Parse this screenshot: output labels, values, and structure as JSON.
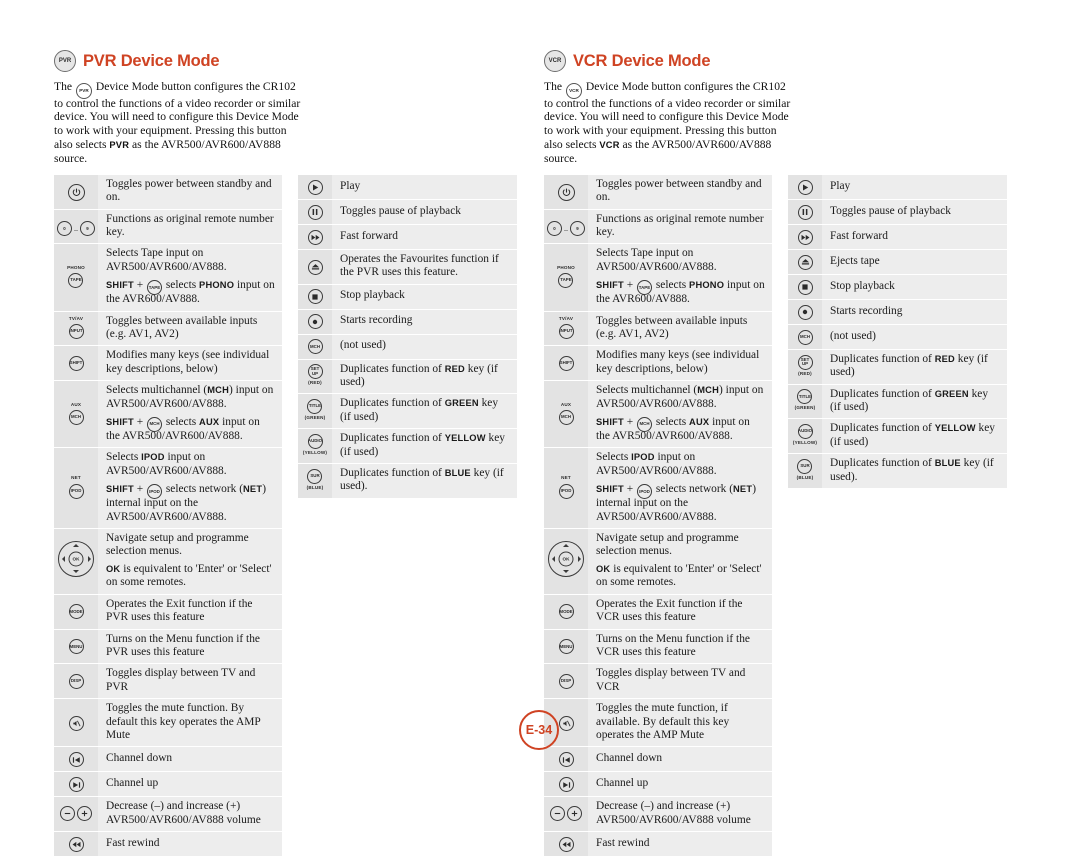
{
  "page": {
    "number_label": "E-34",
    "accent_color": "#cf4323"
  },
  "sections": [
    {
      "id": "pvr",
      "mode_badge": "PVR",
      "title": "PVR Device Mode",
      "intro_pre": "The ",
      "intro_badge": "PVR",
      "intro_mid": " Device Mode button configures the CR102 to control the functions of a video recorder or similar device. You will need to configure this Device Mode to work with your equipment. Pressing this button also selects ",
      "intro_sc": "PVR",
      "intro_post": " as the AVR500/AVR600/AV888 source.",
      "left_rows": [
        {
          "icon": "power-icon",
          "lines": [
            "Toggles power between standby and on."
          ]
        },
        {
          "icon": "number-keys-icon",
          "lines": [
            "Functions as original remote number key."
          ]
        },
        {
          "icon": "phono-tape-icon",
          "lines": [
            "Selects Tape input on AVR500/AVR600/AV888.",
            "SHIFT + TAPE selects PHONO input on the AVR600/AV888."
          ]
        },
        {
          "icon": "tv-av-input-icon",
          "lines": [
            "Toggles between available inputs (e.g. AV1, AV2)"
          ]
        },
        {
          "icon": "shift-icon",
          "lines": [
            "Modifies many keys (see individual key descriptions, below)"
          ]
        },
        {
          "icon": "aux-mch-icon",
          "lines": [
            "Selects multichannel (MCH) input on AVR500/AVR600/AV888.",
            "SHIFT + MCH selects AUX input on the AVR500/AVR600/AV888."
          ]
        },
        {
          "icon": "net-ipod-icon",
          "lines": [
            "Selects IPOD input on AVR500/AVR600/AV888.",
            "SHIFT + IPOD selects network (NET) internal input on the AVR500/AVR600/AV888."
          ]
        },
        {
          "icon": "navigation-dpad-icon",
          "lines": [
            "Navigate setup and programme selection menus.",
            "OK is equivalent to 'Enter' or 'Select' on some remotes."
          ]
        },
        {
          "icon": "mode-exit-icon",
          "lines": [
            "Operates the Exit function if the PVR uses this feature"
          ]
        },
        {
          "icon": "menu-icon",
          "lines": [
            "Turns on the Menu function if the PVR uses this feature"
          ]
        },
        {
          "icon": "display-icon",
          "lines": [
            "Toggles display between TV and PVR"
          ]
        },
        {
          "icon": "mute-icon",
          "lines": [
            "Toggles the mute function. By default this key operates the AMP Mute"
          ]
        },
        {
          "icon": "channel-down-icon",
          "lines": [
            "Channel down"
          ]
        },
        {
          "icon": "channel-up-icon",
          "lines": [
            "Channel up"
          ]
        },
        {
          "icon": "volume-minus-plus-icon",
          "lines": [
            "Decrease (–) and increase (+) AVR500/AVR600/AV888 volume"
          ]
        },
        {
          "icon": "fast-rewind-icon",
          "lines": [
            "Fast rewind"
          ]
        }
      ],
      "right_rows": [
        {
          "icon": "play-icon",
          "lines": [
            "Play"
          ]
        },
        {
          "icon": "pause-icon",
          "lines": [
            "Toggles pause of playback"
          ]
        },
        {
          "icon": "fast-forward-icon",
          "lines": [
            "Fast forward"
          ]
        },
        {
          "icon": "eject-icon",
          "lines": [
            "Operates the Favourites function if the PVR uses this feature."
          ]
        },
        {
          "icon": "stop-icon",
          "lines": [
            "Stop playback"
          ]
        },
        {
          "icon": "record-icon",
          "lines": [
            "Starts recording"
          ]
        },
        {
          "icon": "mch-icon",
          "lines": [
            "(not used)"
          ]
        },
        {
          "icon": "setup-red-icon",
          "lines": [
            "Duplicates function of RED key (if used)"
          ]
        },
        {
          "icon": "title-green-icon",
          "lines": [
            "Duplicates function of GREEN key (if used)"
          ]
        },
        {
          "icon": "audio-yellow-icon",
          "lines": [
            "Duplicates function of YELLOW key (if used)"
          ]
        },
        {
          "icon": "sur-blue-icon",
          "lines": [
            "Duplicates function of BLUE key (if used)."
          ]
        }
      ]
    },
    {
      "id": "vcr",
      "mode_badge": "VCR",
      "title": "VCR Device Mode",
      "intro_pre": "The ",
      "intro_badge": "VCR",
      "intro_mid": " Device Mode button configures the CR102 to control the functions of a video recorder or similar device. You will need to configure this Device Mode to work with your equipment. Pressing this button also selects ",
      "intro_sc": "VCR",
      "intro_post": " as the AVR500/AVR600/AV888 source.",
      "left_rows": [
        {
          "icon": "power-icon",
          "lines": [
            "Toggles power between standby and on."
          ]
        },
        {
          "icon": "number-keys-icon",
          "lines": [
            "Functions as original remote number key."
          ]
        },
        {
          "icon": "phono-tape-icon",
          "lines": [
            "Selects Tape input on AVR500/AVR600/AV888.",
            "SHIFT + TAPE selects PHONO input on the AVR600/AV888."
          ]
        },
        {
          "icon": "tv-av-input-icon",
          "lines": [
            "Toggles between available inputs (e.g. AV1, AV2)"
          ]
        },
        {
          "icon": "shift-icon",
          "lines": [
            "Modifies many keys (see individual key descriptions, below)"
          ]
        },
        {
          "icon": "aux-mch-icon",
          "lines": [
            "Selects multichannel (MCH) input on AVR500/AVR600/AV888.",
            "SHIFT + MCH selects AUX input on the AVR500/AVR600/AV888."
          ]
        },
        {
          "icon": "net-ipod-icon",
          "lines": [
            "Selects IPOD input on AVR500/AVR600/AV888.",
            "SHIFT + IPOD selects network (NET) internal input on the AVR500/AVR600/AV888."
          ]
        },
        {
          "icon": "navigation-dpad-icon",
          "lines": [
            "Navigate setup and programme selection menus.",
            "OK is equivalent to 'Enter' or 'Select' on some remotes."
          ]
        },
        {
          "icon": "mode-exit-icon",
          "lines": [
            "Operates the Exit function if the VCR uses this feature"
          ]
        },
        {
          "icon": "menu-icon",
          "lines": [
            "Turns on the Menu function if the VCR uses this feature"
          ]
        },
        {
          "icon": "display-icon",
          "lines": [
            "Toggles display between TV and VCR"
          ]
        },
        {
          "icon": "mute-icon",
          "lines": [
            "Toggles the mute function, if available. By default this key operates the AMP Mute"
          ]
        },
        {
          "icon": "channel-down-icon",
          "lines": [
            "Channel down"
          ]
        },
        {
          "icon": "channel-up-icon",
          "lines": [
            "Channel up"
          ]
        },
        {
          "icon": "volume-minus-plus-icon",
          "lines": [
            "Decrease (–) and increase (+) AVR500/AVR600/AV888 volume"
          ]
        },
        {
          "icon": "fast-rewind-icon",
          "lines": [
            "Fast rewind"
          ]
        }
      ],
      "right_rows": [
        {
          "icon": "play-icon",
          "lines": [
            "Play"
          ]
        },
        {
          "icon": "pause-icon",
          "lines": [
            "Toggles pause of playback"
          ]
        },
        {
          "icon": "fast-forward-icon",
          "lines": [
            "Fast forward"
          ]
        },
        {
          "icon": "eject-icon",
          "lines": [
            "Ejects tape"
          ]
        },
        {
          "icon": "stop-icon",
          "lines": [
            "Stop playback"
          ]
        },
        {
          "icon": "record-icon",
          "lines": [
            "Starts recording"
          ]
        },
        {
          "icon": "mch-icon",
          "lines": [
            "(not used)"
          ]
        },
        {
          "icon": "setup-red-icon",
          "lines": [
            "Duplicates function of RED key (if used)"
          ]
        },
        {
          "icon": "title-green-icon",
          "lines": [
            "Duplicates function of GREEN key (if used)"
          ]
        },
        {
          "icon": "audio-yellow-icon",
          "lines": [
            "Duplicates function of YELLOW key (if used)"
          ]
        },
        {
          "icon": "sur-blue-icon",
          "lines": [
            "Duplicates function of BLUE key (if used)."
          ]
        }
      ]
    }
  ],
  "button_captions": {
    "power": "⏻",
    "num_from": "0",
    "num_dots": "..",
    "num_to": "9",
    "phono_cap": "PHONO",
    "tape": "TAPE",
    "tvav_cap": "TV/AV",
    "input": "INPUT",
    "shift": "SHIFT",
    "aux_cap": "AUX",
    "mch": "MCH",
    "net_cap": "NET",
    "ipod": "IPOD",
    "ok": "OK",
    "mode": "MODE",
    "menu": "MENU",
    "disp": "DISP",
    "setup": "SET UP",
    "red": "(RED)",
    "title": "TITLE",
    "green": "(GREEN)",
    "audio": "AUDIO",
    "yellow": "(YELLOW)",
    "sur": "SUR",
    "blue": "(BLUE)"
  }
}
